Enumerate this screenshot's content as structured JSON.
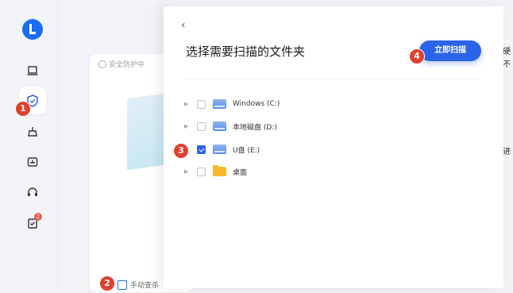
{
  "sidebar": {
    "items": [
      {
        "icon": "laptop-icon",
        "active": false
      },
      {
        "icon": "shield-check-icon",
        "active": true
      },
      {
        "icon": "broom-icon",
        "active": false
      },
      {
        "icon": "backup-icon",
        "active": false
      },
      {
        "icon": "headset-icon",
        "active": false
      },
      {
        "icon": "clipboard-check-icon",
        "active": false,
        "badge": "2"
      }
    ]
  },
  "background": {
    "status": "安全防护中",
    "manual": "手动查杀",
    "right_text": [
      "硬",
      "不",
      "进"
    ]
  },
  "panel": {
    "title": "选择需要扫描的文件夹",
    "scan_button": "立即扫描",
    "items": [
      {
        "label": "Windows (C:)",
        "type": "disk",
        "checked": false
      },
      {
        "label": "本地磁盘 (D:)",
        "type": "disk",
        "checked": false
      },
      {
        "label": "U盘 (E:)",
        "type": "disk",
        "checked": true
      },
      {
        "label": "桌面",
        "type": "folder",
        "checked": false
      }
    ]
  },
  "steps": [
    "1",
    "2",
    "3",
    "4"
  ],
  "colors": {
    "accent": "#2b64e8",
    "step_marker": "#e0402c",
    "badge": "#f05a4a"
  }
}
